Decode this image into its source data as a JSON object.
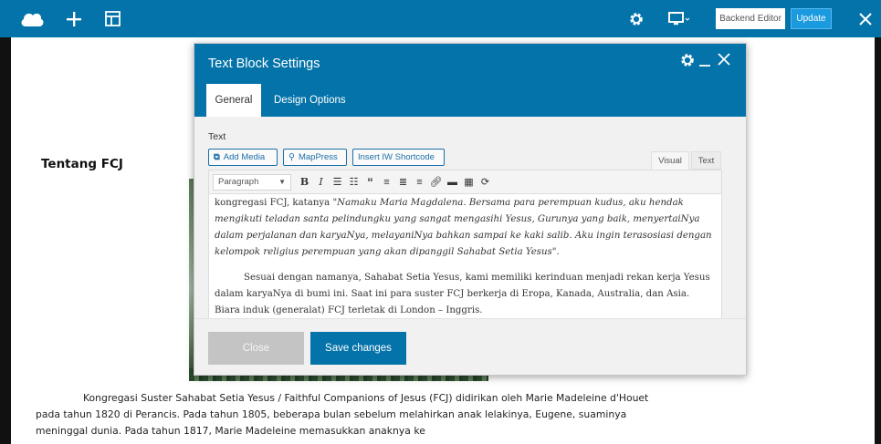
{
  "topbar": {
    "logo_icon": "cloud-logo-icon",
    "add_icon": "plus-icon",
    "templates_icon": "layout-icon",
    "settings_icon": "gear-icon",
    "responsive_icon": "monitor-icon",
    "backend_editor_label": "Backend Editor",
    "update_label": "Update",
    "close_icon": "close-icon"
  },
  "page": {
    "section_title": "Tentang FCJ",
    "paragraph": "Kongregasi Suster Sahabat Setia Yesus / Faithful Companions of Jesus (FCJ) didirikan oleh Marie Madeleine d'Houet pada tahun 1820 di Perancis. Pada tahun 1805, beberapa bulan sebelum melahirkan anak lelakinya, Eugene, suaminya meninggal dunia. Pada tahun 1817, Marie Madeleine memasukkan anaknya ke"
  },
  "modal": {
    "title": "Text Block Settings",
    "tabs": [
      {
        "label": "General",
        "active": true
      },
      {
        "label": "Design Options",
        "active": false
      }
    ],
    "field_label": "Text",
    "media_buttons": [
      "Add Media",
      "MapPress",
      "Insert IW Shortcode"
    ],
    "editor_tabs": [
      "Visual",
      "Text"
    ],
    "format_select": "Paragraph",
    "editor": {
      "line1_prefix": "kongregasi FCJ,  katanya ",
      "quote": "\"Namaku Maria Magdalena. Bersama para perempuan kudus, aku hendak mengikuti teladan santa pelindungku yang sangat mengasihi Yesus, Gurunya yang baik, menyertaiNya dalam perjalanan dan karyaNya, melayaniNya bahkan sampai ke kaki salib.  Aku ingin terasosiasi dengan kelompok religius perempuan yang akan dipanggil Sahabat Setia Yesus\".",
      "paragraph2": "Sesuai dengan namanya, Sahabat Setia Yesus, kami memiliki kerinduan menjadi rekan kerja Yesus dalam karyaNya di bumi ini.  Saat ini para suster FCJ berkerja di Eropa, Kanada, Australia, dan Asia.  Biara induk (generalat) FCJ terletak di London – Inggris."
    },
    "close_label": "Close",
    "save_label": "Save changes"
  },
  "colors": {
    "brand_blue": "#0473aa",
    "update_blue": "#1a9be0"
  }
}
